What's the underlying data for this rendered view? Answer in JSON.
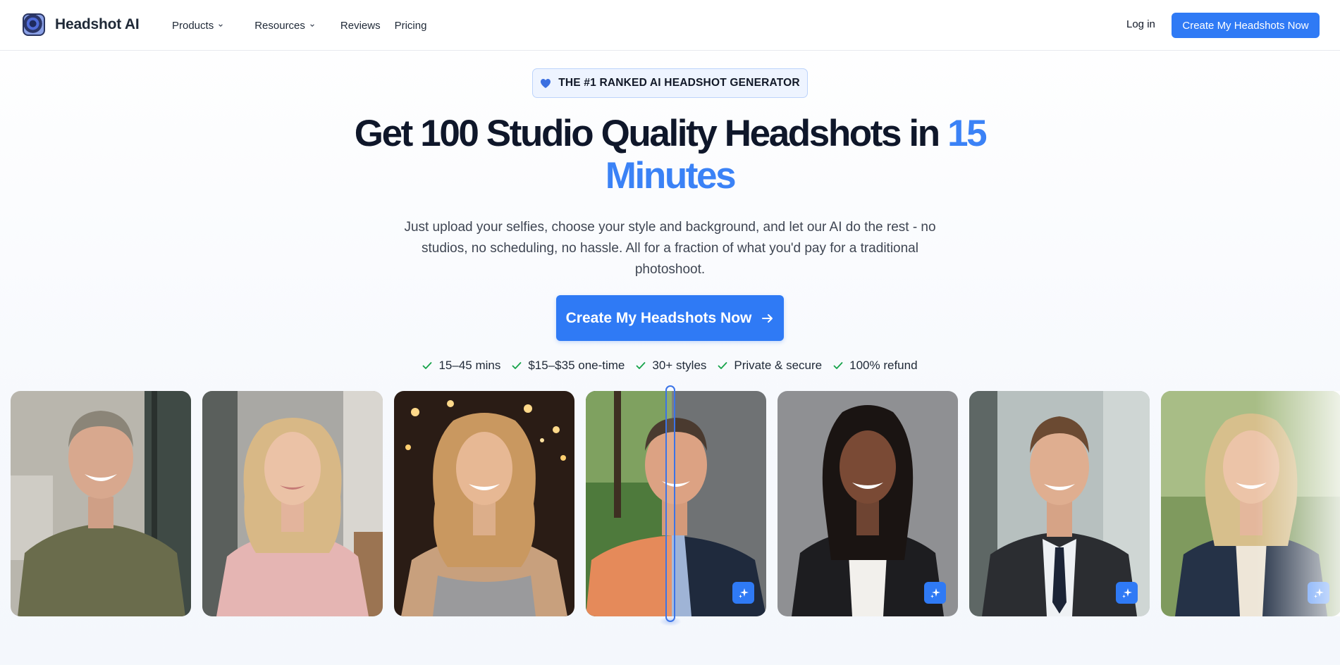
{
  "header": {
    "brand": "Headshot AI",
    "nav": [
      {
        "label": "Products",
        "has_dropdown": true
      },
      {
        "label": "Resources",
        "has_dropdown": true
      },
      {
        "label": "Reviews",
        "has_dropdown": false
      },
      {
        "label": "Pricing",
        "has_dropdown": false
      }
    ],
    "login_label": "Log in",
    "cta_label": "Create My Headshots Now"
  },
  "hero": {
    "badge_icon": "heart-icon",
    "badge_text": "THE #1 RANKED AI HEADSHOT GENERATOR",
    "headline_main": "Get 100 Studio Quality Headshots in",
    "headline_accent": "15 Minutes",
    "subtext": "Just upload your selfies, choose your style and background, and let our AI do the rest - no studios, no scheduling, no hassle. All for a fraction of what you'd pay for a traditional photoshoot.",
    "cta_label": "Create My Headshots Now",
    "features": [
      "15–45 mins",
      "$15–$35 one-time",
      "30+ styles",
      "Private & secure",
      "100% refund"
    ]
  },
  "gallery": {
    "photos": [
      {
        "name": "man-green-tshirt-photo",
        "sparkle": false
      },
      {
        "name": "woman-pink-tshirt-photo",
        "sparkle": false
      },
      {
        "name": "woman-sequin-top-photo",
        "sparkle": false
      },
      {
        "name": "before-after-comparison-photo",
        "sparkle": true
      },
      {
        "name": "woman-black-blazer-photo",
        "sparkle": true
      },
      {
        "name": "man-suit-tie-photo",
        "sparkle": true
      },
      {
        "name": "woman-navy-blazer-photo",
        "sparkle": true
      }
    ]
  },
  "colors": {
    "accent": "#2f7af5",
    "headline_accent": "#3b82f6",
    "check": "#16a34a"
  }
}
